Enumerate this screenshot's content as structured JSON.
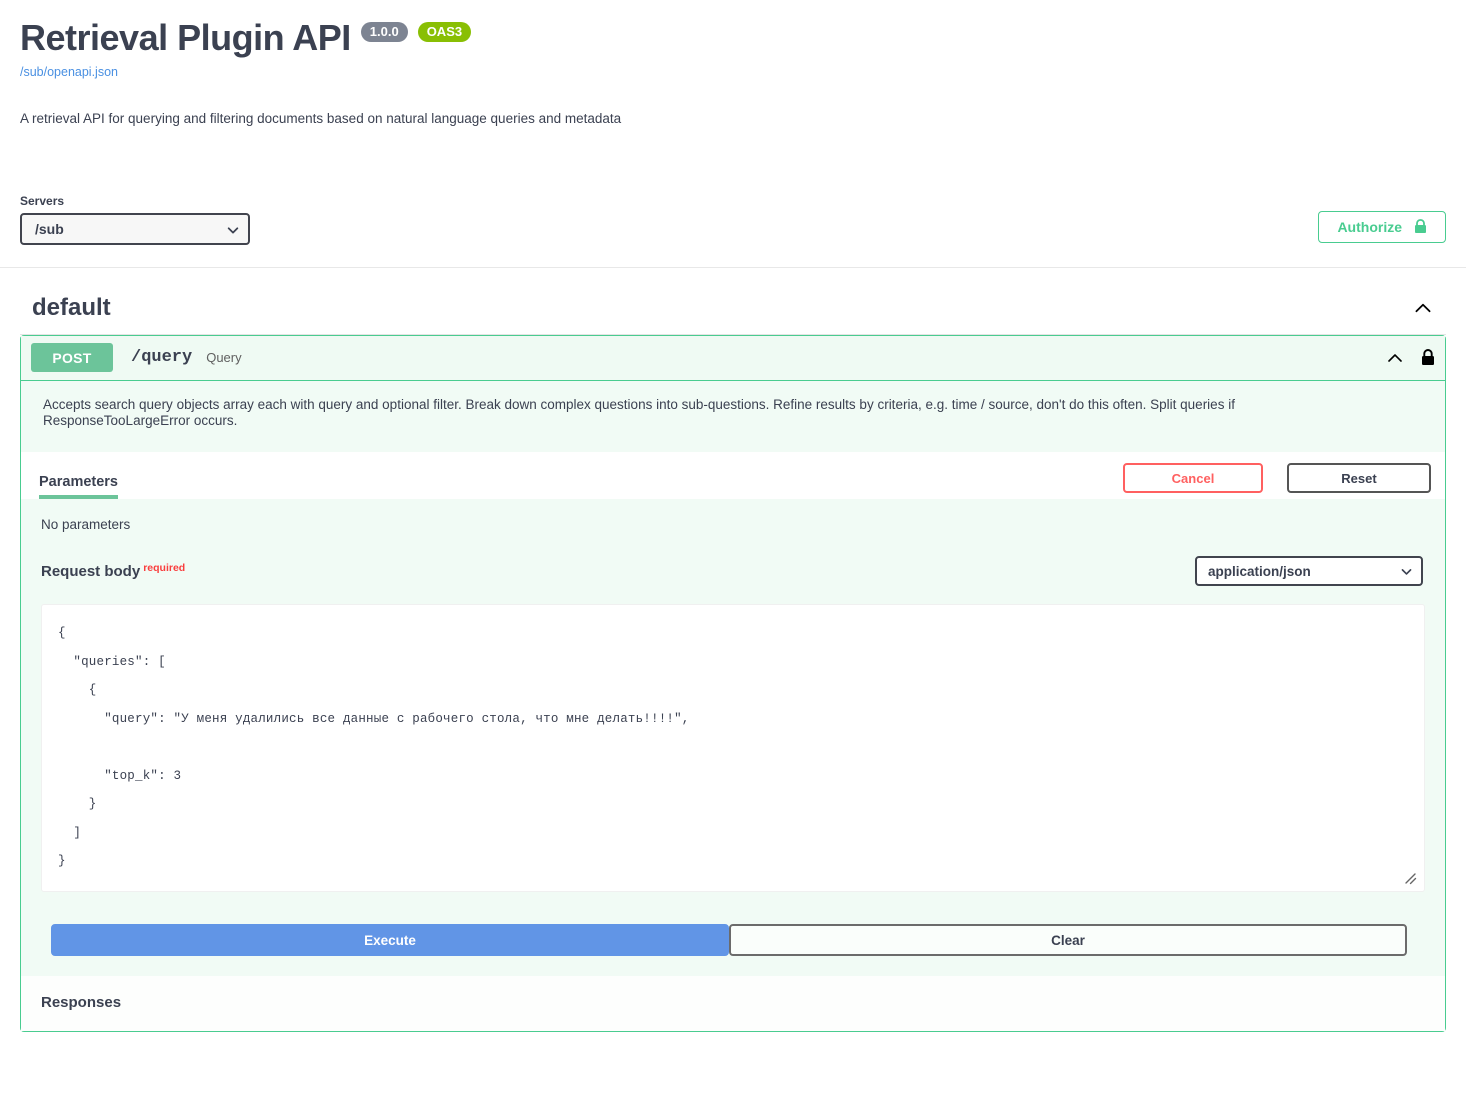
{
  "info": {
    "title": "Retrieval Plugin API",
    "version_badge": "1.0.0",
    "oas_badge": "OAS3",
    "spec_link": "/sub/openapi.json",
    "description": "A retrieval API for querying and filtering documents based on natural language queries and metadata"
  },
  "servers": {
    "label": "Servers",
    "selected": "/sub",
    "chevron_icon": "chevron-down-icon"
  },
  "authorize": {
    "label": "Authorize",
    "lock_icon": "lock-closed-icon",
    "accent_color": "#49cc90"
  },
  "tag": {
    "name": "default",
    "collapse_icon": "chevron-up-icon"
  },
  "operation": {
    "method": "POST",
    "path": "/query",
    "summary": "Query",
    "collapse_icon": "chevron-up-icon",
    "lock_icon": "lock-closed-icon",
    "description": "Accepts search query objects array each with query and optional filter. Break down complex questions into sub-questions. Refine results by criteria, e.g. time / source, don't do this often. Split queries if ResponseTooLargeError occurs.",
    "method_color": "#49cc90"
  },
  "tabs": {
    "parameters_label": "Parameters",
    "cancel_label": "Cancel",
    "reset_label": "Reset",
    "no_parameters": "No parameters",
    "cancel_color": "#ff6060"
  },
  "request_body": {
    "label": "Request body",
    "required_label": "required",
    "content_type": "application/json",
    "chevron_icon": "chevron-down-icon",
    "value": "{\n  \"queries\": [\n    {\n      \"query\": \"У меня удалились все данные с рабочего стола, что мне делать!!!!\",\n\n      \"top_k\": 3\n    }\n  ]\n}",
    "resize_icon": "resize-grip-icon"
  },
  "actions": {
    "execute_label": "Execute",
    "clear_label": "Clear",
    "execute_color": "#6195e6"
  },
  "responses": {
    "title": "Responses"
  }
}
